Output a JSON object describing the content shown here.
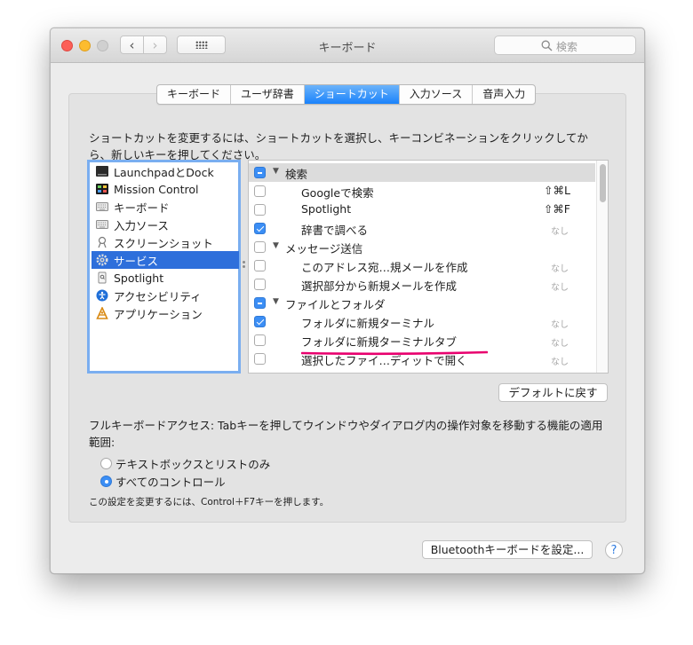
{
  "window": {
    "title": "キーボード"
  },
  "toolbar": {
    "back_glyph": "‹",
    "forward_glyph": "›",
    "grid_icon": "grid-icon"
  },
  "search": {
    "placeholder": "検索"
  },
  "tabs": [
    {
      "label": "キーボード",
      "active": false
    },
    {
      "label": "ユーザ辞書",
      "active": false
    },
    {
      "label": "ショートカット",
      "active": true
    },
    {
      "label": "入力ソース",
      "active": false
    },
    {
      "label": "音声入力",
      "active": false
    }
  ],
  "description": "ショートカットを変更するには、ショートカットを選択し、キーコンビネーションをクリックしてから、新しいキーを押してください。",
  "categories": [
    {
      "label": "LaunchpadとDock",
      "icon": "launchpad-icon",
      "selected": false
    },
    {
      "label": "Mission Control",
      "icon": "mission-control-icon",
      "selected": false
    },
    {
      "label": "キーボード",
      "icon": "keyboard-icon",
      "selected": false
    },
    {
      "label": "入力ソース",
      "icon": "keyboard-icon",
      "selected": false
    },
    {
      "label": "スクリーンショット",
      "icon": "screenshot-icon",
      "selected": false
    },
    {
      "label": "サービス",
      "icon": "gear-icon",
      "selected": true
    },
    {
      "label": "Spotlight",
      "icon": "spotlight-icon",
      "selected": false
    },
    {
      "label": "アクセシビリティ",
      "icon": "accessibility-icon",
      "selected": false
    },
    {
      "label": "アプリケーション",
      "icon": "app-store-icon",
      "selected": false
    }
  ],
  "shortcuts": [
    {
      "type": "group",
      "label": "検索",
      "state": "mixed"
    },
    {
      "type": "item",
      "label": "Googleで検索",
      "state": "off",
      "shortcut": "⇧⌘L"
    },
    {
      "type": "item",
      "label": "Spotlight",
      "state": "off",
      "shortcut": "⇧⌘F"
    },
    {
      "type": "item",
      "label": "辞書で調べる",
      "state": "on",
      "shortcut": "なし"
    },
    {
      "type": "group",
      "label": "メッセージ送信",
      "state": "off"
    },
    {
      "type": "item",
      "label": "このアドレス宛…規メールを作成",
      "state": "off",
      "shortcut": "なし"
    },
    {
      "type": "item",
      "label": "選択部分から新規メールを作成",
      "state": "off",
      "shortcut": "なし"
    },
    {
      "type": "group",
      "label": "ファイルとフォルダ",
      "state": "mixed"
    },
    {
      "type": "item",
      "label": "フォルダに新規ターミナル",
      "state": "on",
      "shortcut": "なし"
    },
    {
      "type": "item",
      "label": "フォルダに新規ターミナルタブ",
      "state": "off",
      "shortcut": "なし"
    },
    {
      "type": "item",
      "label": "選択したファイ…ディットで開く",
      "state": "off",
      "shortcut": "なし"
    }
  ],
  "colors": {
    "accent": "#1a82fb",
    "selection": "#2e6fdb",
    "highlight_underline": "#e8006e"
  },
  "default_button": "デフォルトに戻す",
  "full_keyboard": {
    "text": "フルキーボードアクセス: Tabキーを押してウインドウやダイアログ内の操作対象を移動する機能の適用範囲:",
    "options": [
      {
        "label": "テキストボックスとリストのみ",
        "selected": false
      },
      {
        "label": "すべてのコントロール",
        "selected": true
      }
    ],
    "note": "この設定を変更するには、Control＋F7キーを押します。"
  },
  "bluetooth_button": "Bluetoothキーボードを設定...",
  "help": {
    "glyph": "?"
  }
}
